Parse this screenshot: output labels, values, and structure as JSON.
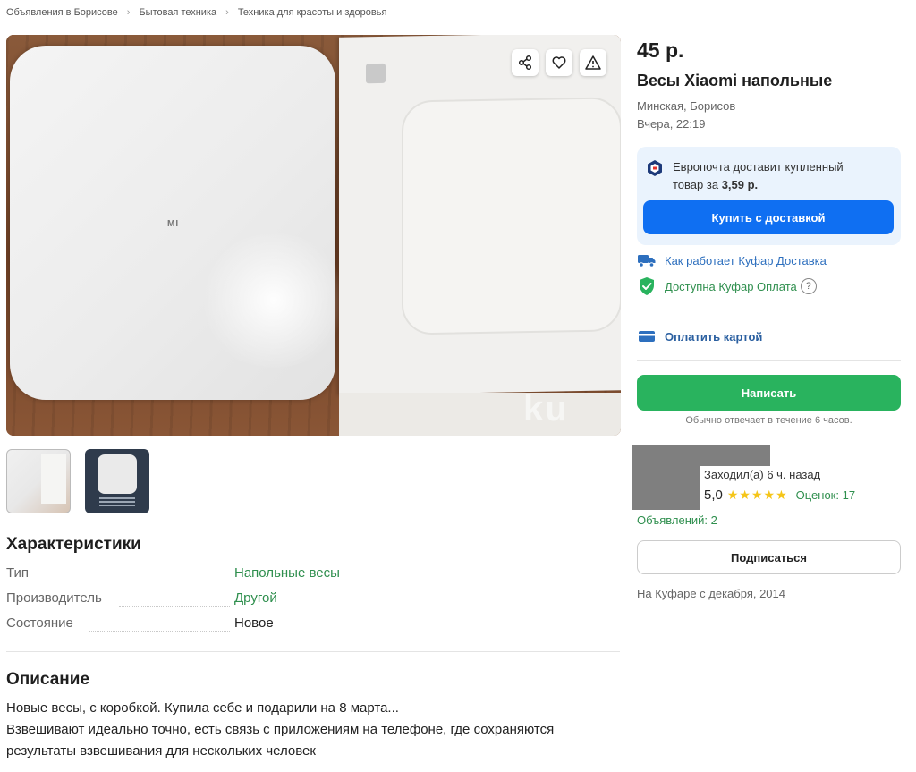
{
  "breadcrumb": [
    "Объявления в Борисове",
    "Бытовая техника",
    "Техника для красоты и здоровья"
  ],
  "listing": {
    "price": "45 р.",
    "title": "Весы Xiaomi напольные",
    "location": "Минская, Борисов",
    "date": "Вчера, 22:19"
  },
  "photo": {
    "product_mark": "MI",
    "watermark": "ku"
  },
  "delivery": {
    "text_part1": "Европочта доставит купленный",
    "text_part2": "товар за",
    "price": "3,59 р.",
    "button": "Купить с доставкой"
  },
  "features": {
    "how_it_works": "Как работает Куфар Доставка",
    "payment_available": "Доступна Куфар Оплата",
    "help": "?",
    "pay_by_card": "Оплатить картой"
  },
  "contact": {
    "write_button": "Написать",
    "reply_note": "Обычно отвечает в течение 6 часов."
  },
  "seller": {
    "last_seen": "Заходил(а) 6 ч. назад",
    "rating": "5,0",
    "stars": "★★★★★",
    "ratings_count": "Оценок: 17",
    "ads_count": "Объявлений: 2",
    "subscribe_button": "Подписаться",
    "since": "На Куфаре с декабря, 2014"
  },
  "characteristics": {
    "heading": "Характеристики",
    "items": [
      {
        "key": "Тип",
        "value": "Напольные весы",
        "link": true
      },
      {
        "key": "Производитель",
        "value": "Другой",
        "link": true
      },
      {
        "key": "Состояние",
        "value": "Новое",
        "link": false
      }
    ]
  },
  "description": {
    "heading": "Описание",
    "lines": [
      "Новые весы, с коробкой. Купила себе и подарили на 8 марта...",
      "Взвешивают идеально точно, есть связь с приложениям на телефоне, где сохраняются",
      "результаты взвешивания для нескольких человек"
    ]
  },
  "colors": {
    "blue": "#0f6ff2",
    "green": "#29b35e",
    "link_green": "#2f8f4e",
    "link_blue": "#2d6fbe",
    "star": "#f5c518"
  }
}
